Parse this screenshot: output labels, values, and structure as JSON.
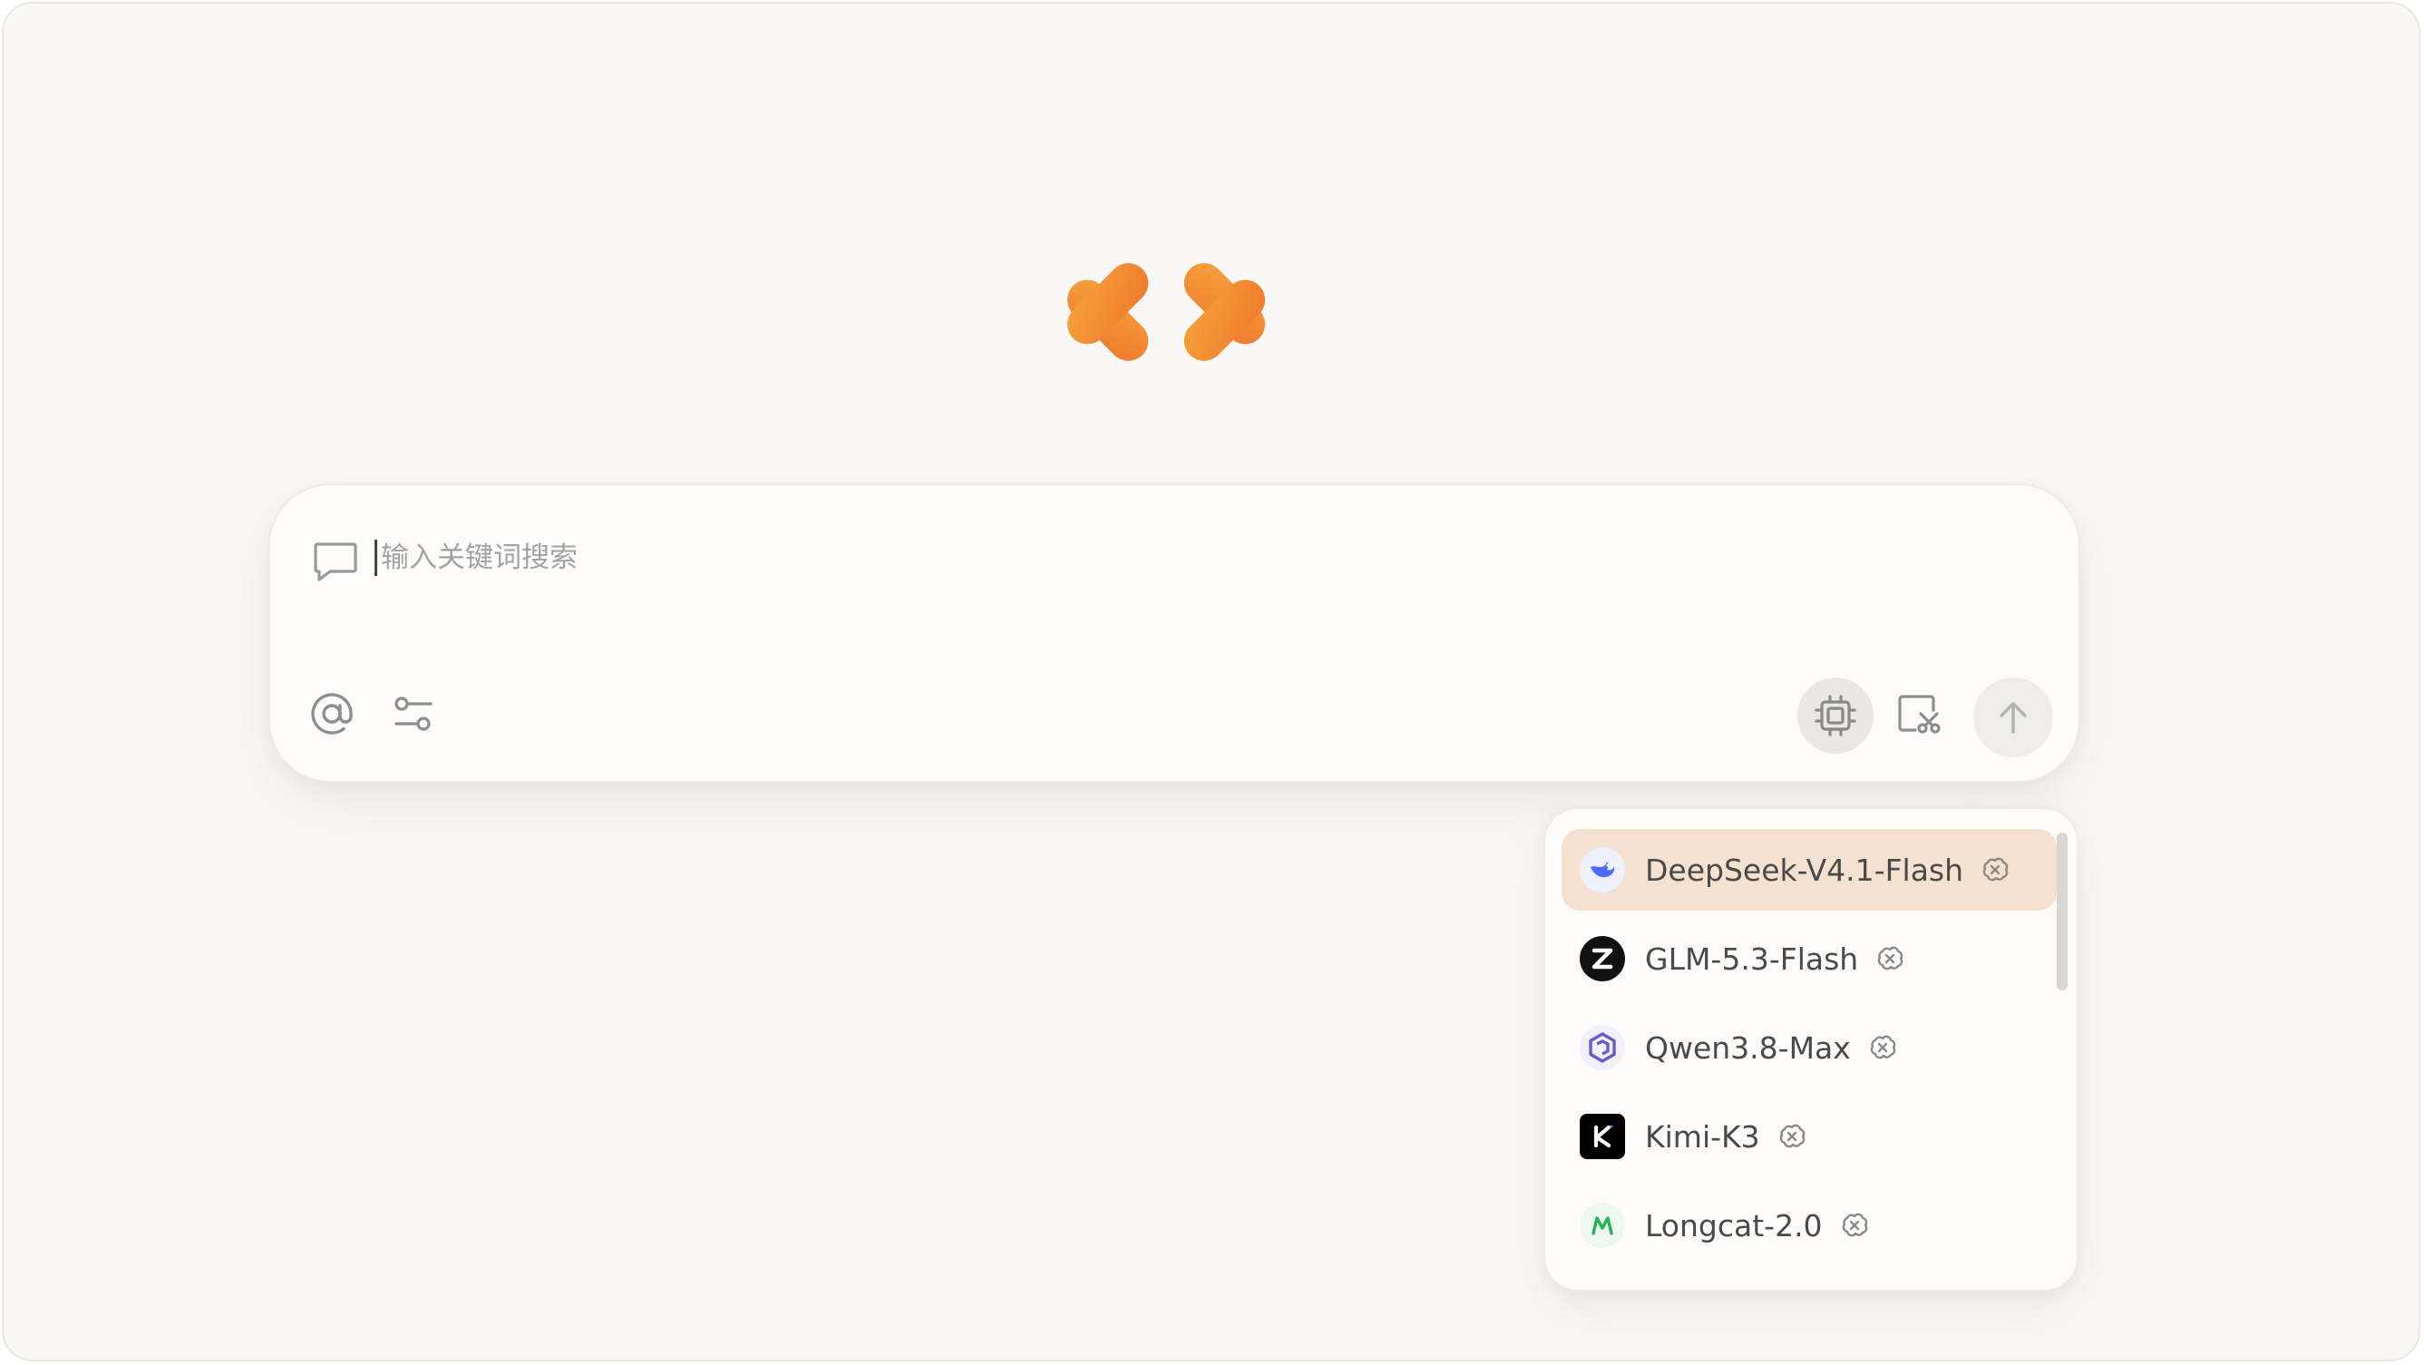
{
  "app": {
    "logo": "orange-blocks-logo"
  },
  "composer": {
    "placeholder": "输入关键词搜索",
    "value": "",
    "icons": {
      "chat": "chat-bubble-icon",
      "mention": "at-sign-icon",
      "settings": "sliders-icon",
      "model": "chip-icon",
      "screenshot": "crop-scissors-icon",
      "send": "arrow-up-icon"
    }
  },
  "model_menu": {
    "selected_index": 0,
    "items": [
      {
        "label": "DeepSeek-V4.1-Flash",
        "logo": "deepseek-whale-logo",
        "thinking": true
      },
      {
        "label": "GLM-5.3-Flash",
        "logo": "zhipu-z-logo",
        "thinking": true
      },
      {
        "label": "Qwen3.8-Max",
        "logo": "qwen-logo",
        "thinking": true
      },
      {
        "label": "Kimi-K3",
        "logo": "kimi-k-logo",
        "thinking": true
      },
      {
        "label": "Longcat-2.0",
        "logo": "longcat-logo",
        "thinking": true
      }
    ]
  },
  "colors": {
    "accent": "#f08a35",
    "selected_bg": "#f5e1d0",
    "background": "#f9f8f6"
  }
}
